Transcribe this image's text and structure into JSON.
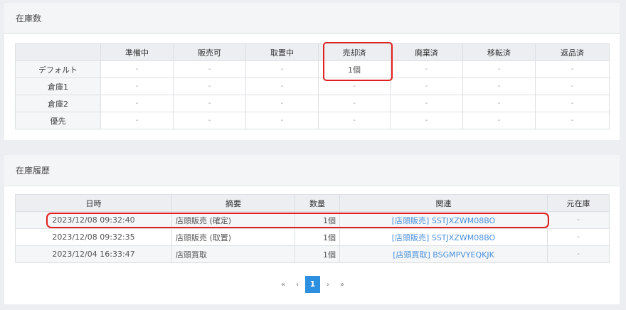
{
  "stock": {
    "title": "在庫数",
    "columns": [
      "準備中",
      "販売可",
      "取置中",
      "売却済",
      "廃棄済",
      "移転済",
      "返品済"
    ],
    "rows": [
      {
        "label": "デフォルト",
        "cells": [
          "-",
          "-",
          "-",
          "1個",
          "-",
          "-",
          "-"
        ]
      },
      {
        "label": "倉庫1",
        "cells": [
          "-",
          "-",
          "-",
          "-",
          "-",
          "-",
          "-"
        ]
      },
      {
        "label": "倉庫2",
        "cells": [
          "-",
          "-",
          "-",
          "-",
          "-",
          "-",
          "-"
        ]
      },
      {
        "label": "優先",
        "cells": [
          "-",
          "-",
          "-",
          "-",
          "-",
          "-",
          "-"
        ]
      }
    ]
  },
  "history": {
    "title": "在庫履歴",
    "columns": [
      "日時",
      "摘要",
      "数量",
      "関連",
      "元在庫"
    ],
    "rows": [
      {
        "datetime": "2023/12/08 09:32:40",
        "summary": "店頭販売 (確定)",
        "qty": "1個",
        "related": "[店頭販売] SSTJXZWM08BO",
        "origin": "-"
      },
      {
        "datetime": "2023/12/08 09:32:35",
        "summary": "店頭販売 (取置)",
        "qty": "1個",
        "related": "[店頭販売] SSTJXZWM08BO",
        "origin": "-"
      },
      {
        "datetime": "2023/12/04 16:33:47",
        "summary": "店頭買取",
        "qty": "1個",
        "related": "[店頭買取] BSGMPVYEQKJK",
        "origin": "-"
      }
    ]
  },
  "pagination": {
    "first": "«",
    "prev": "‹",
    "current": "1",
    "next": "›",
    "last": "»"
  },
  "colors": {
    "highlight": "#e02020",
    "link": "#4a90d9",
    "active_page": "#2d8fe0"
  }
}
